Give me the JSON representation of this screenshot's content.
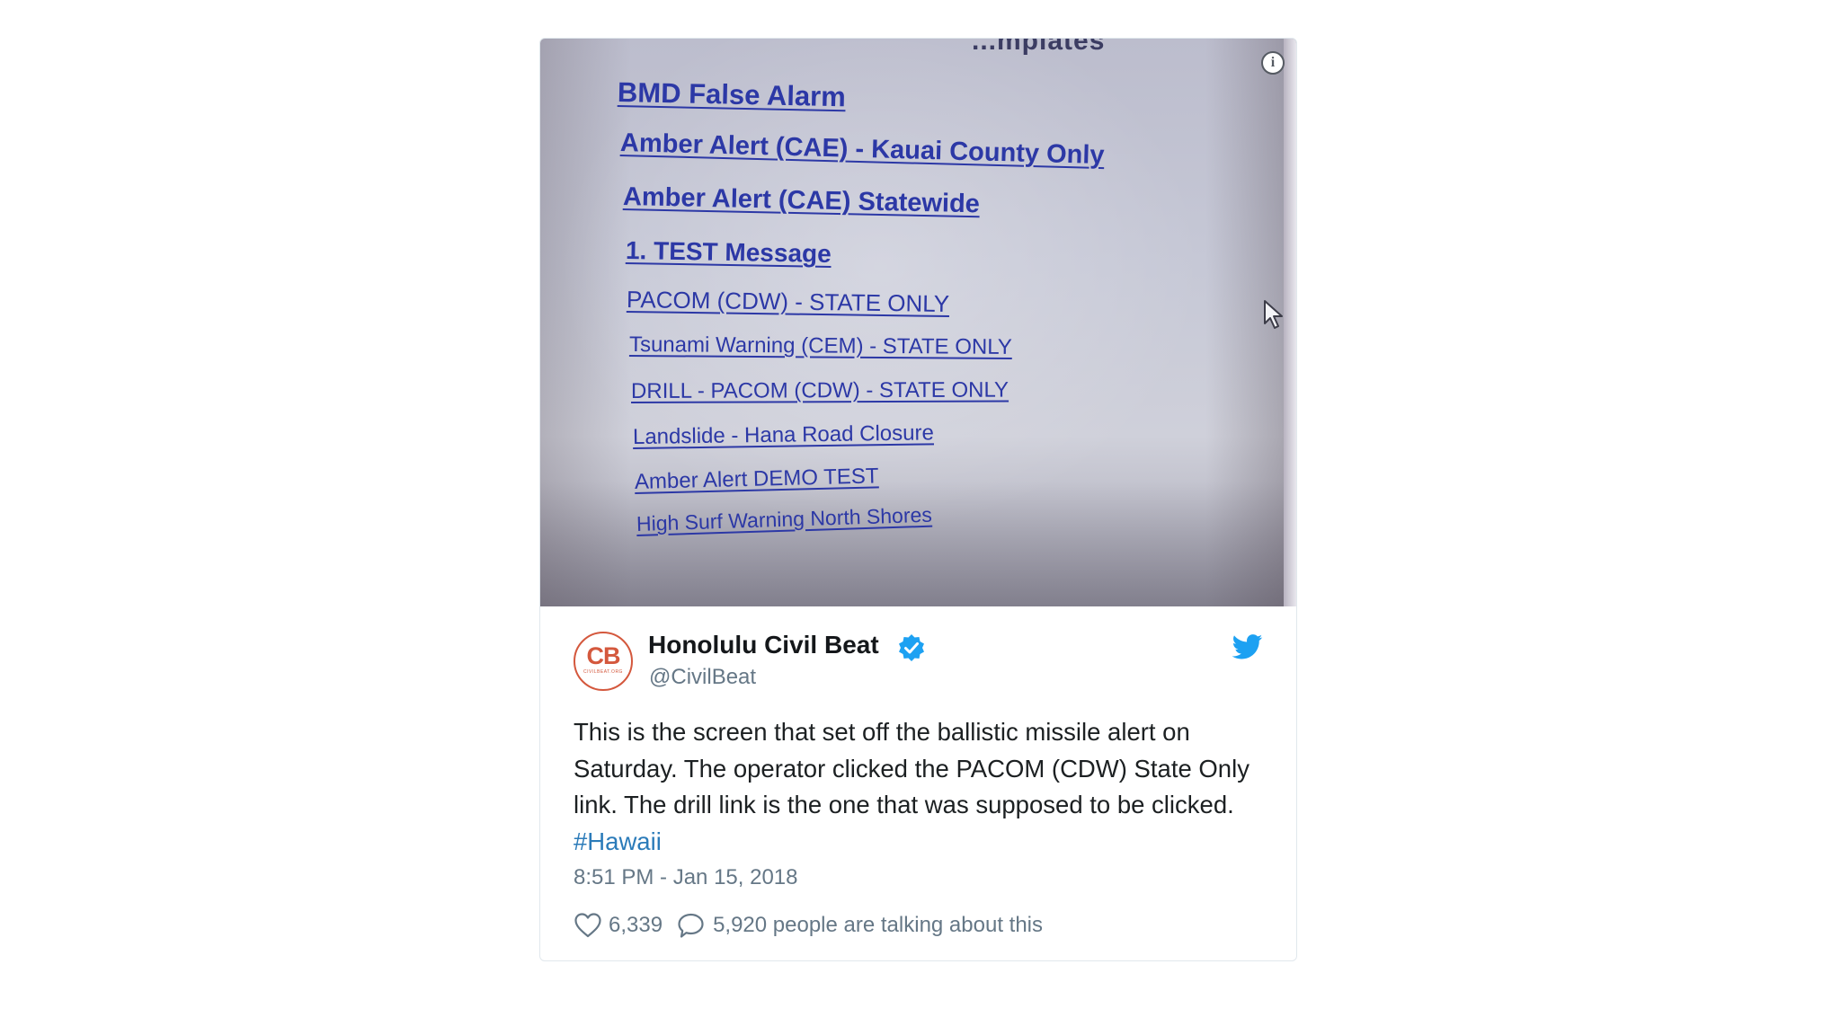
{
  "tweet": {
    "photo": {
      "top_text": "...mplates",
      "links": [
        {
          "text": "BMD False Alarm"
        },
        {
          "text": "Amber Alert (CAE) - Kauai County Only"
        },
        {
          "text": "Amber Alert (CAE) Statewide"
        },
        {
          "text": "1. TEST Message"
        },
        {
          "text": "PACOM (CDW) - STATE ONLY"
        },
        {
          "text": "Tsunami Warning (CEM) - STATE ONLY"
        },
        {
          "text": "DRILL - PACOM (CDW) - STATE ONLY"
        },
        {
          "text": "Landslide - Hana Road Closure"
        },
        {
          "text": "Amber Alert DEMO TEST"
        },
        {
          "text": "High Surf Warning North Shores"
        }
      ],
      "info_icon": "info-icon",
      "cursor_icon": "cursor-icon"
    },
    "avatar": {
      "text": "CB",
      "subtext": "CIVILBEAT.ORG"
    },
    "author": {
      "display_name": "Honolulu Civil Beat",
      "handle": "@CivilBeat",
      "verified_icon": "verified-badge-icon"
    },
    "brand_icon": "twitter-bird-icon",
    "text": "This is the screen that set off the ballistic missile alert on Saturday. The operator clicked the PACOM (CDW) State Only link. The drill link is the one that was supposed to be clicked.",
    "hashtag": "#Hawaii",
    "timestamp": "8:51 PM - Jan 15, 2018",
    "likes": "6,339",
    "talking": "5,920 people are talking about this",
    "colors": {
      "link_blue": "#2b7bb9",
      "twitter_blue": "#1da1f2",
      "avatar_orange": "#d4583d",
      "secondary_text": "#657786"
    }
  }
}
